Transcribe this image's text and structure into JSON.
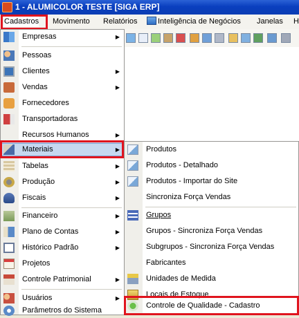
{
  "window": {
    "title": "1 - ALUMICOLOR TESTE [SIGA ERP]"
  },
  "menubar": {
    "items": [
      {
        "label": "Cadastros"
      },
      {
        "label": "Movimento"
      },
      {
        "label": "Relatórios"
      },
      {
        "label": "Inteligência de Negócios"
      },
      {
        "label": "Janelas"
      },
      {
        "label": "H"
      }
    ]
  },
  "cadastros_menu": {
    "items": [
      {
        "label": "Empresas",
        "icon": "buildings-icon",
        "submenu": true
      },
      {
        "label": "Pessoas",
        "icon": "people-icon",
        "submenu": false
      },
      {
        "label": "Clientes",
        "icon": "client-monitor-icon",
        "submenu": true
      },
      {
        "label": "Vendas",
        "icon": "briefcase-icon",
        "submenu": true
      },
      {
        "label": "Fornecedores",
        "icon": "supplier-icon",
        "submenu": false
      },
      {
        "label": "Transportadoras",
        "icon": "truck-icon",
        "submenu": false
      },
      {
        "label": "Recursos Humanos",
        "icon": "hr-icon",
        "submenu": true
      },
      {
        "label": "Materiais",
        "icon": "box-icon",
        "submenu": true
      },
      {
        "label": "Tabelas",
        "icon": "tables-icon",
        "submenu": true
      },
      {
        "label": "Produção",
        "icon": "gears-icon",
        "submenu": true
      },
      {
        "label": "Fiscais",
        "icon": "fiscal-icon",
        "submenu": true
      },
      {
        "label": "Financeiro",
        "icon": "money-icon",
        "submenu": true
      },
      {
        "label": "Plano de Contas",
        "icon": "chart-accounts-icon",
        "submenu": true
      },
      {
        "label": "Histórico Padrão",
        "icon": "history-icon",
        "submenu": true
      },
      {
        "label": "Projetos",
        "icon": "calendar-icon",
        "submenu": false
      },
      {
        "label": "Controle Patrimonial",
        "icon": "house-icon",
        "submenu": true
      },
      {
        "label": "Usuários",
        "icon": "users-icon",
        "submenu": true
      },
      {
        "label": "Parâmetros do Sistema",
        "icon": "settings-icon",
        "submenu": false
      }
    ]
  },
  "materiais_menu": {
    "items": [
      {
        "label": "Produtos",
        "icon": "product-icon"
      },
      {
        "label": "Produtos - Detalhado",
        "icon": "product-detail-icon"
      },
      {
        "label": "Produtos - Importar do Site",
        "icon": "import-icon"
      },
      {
        "label": "Sincroniza Força Vendas",
        "icon": ""
      },
      {
        "label": "Grupos",
        "icon": "groups-icon"
      },
      {
        "label": "Grupos - Sincroniza Força Vendas",
        "icon": ""
      },
      {
        "label": "Subgrupos - Sincroniza Força Vendas",
        "icon": ""
      },
      {
        "label": "Fabricantes",
        "icon": ""
      },
      {
        "label": "Unidades de Medida",
        "icon": "scale-icon"
      },
      {
        "label": "Locais de Estoque",
        "icon": "stock-location-icon"
      },
      {
        "label": "Controle de Qualidade - Cadastro",
        "icon": "quality-check-icon"
      }
    ]
  },
  "colors": {
    "highlight_box": "#e0141e",
    "menu_hover": "#c6d8f0",
    "titlebar": "#0a3fbf"
  }
}
